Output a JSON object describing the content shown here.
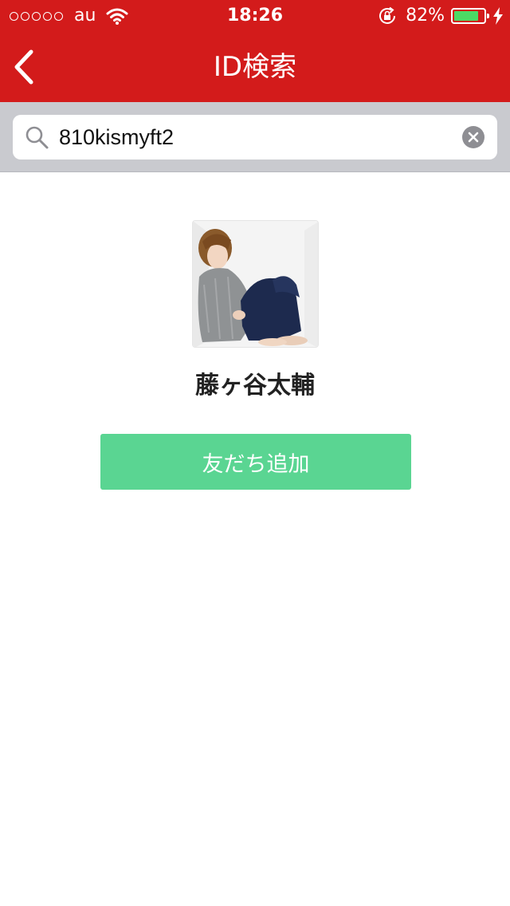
{
  "status_bar": {
    "carrier": "au",
    "time": "18:26",
    "battery_percent": "82%",
    "battery_level": 0.82,
    "icons": [
      "signal-dots-icon",
      "wifi-icon",
      "rotation-lock-icon",
      "battery-icon",
      "charging-bolt-icon"
    ]
  },
  "nav": {
    "title": "ID検索",
    "back_icon": "chevron-left-icon"
  },
  "search": {
    "value": "810kismyft2",
    "icons": [
      "search-icon",
      "clear-icon"
    ]
  },
  "result": {
    "name": "藤ヶ谷太輔",
    "add_button_label": "友だち追加",
    "avatar_icon": "profile-photo"
  },
  "colors": {
    "header": "#d31b1b",
    "search_area": "#c9cacf",
    "add_button": "#5ad592",
    "battery_fill": "#4cd964"
  }
}
